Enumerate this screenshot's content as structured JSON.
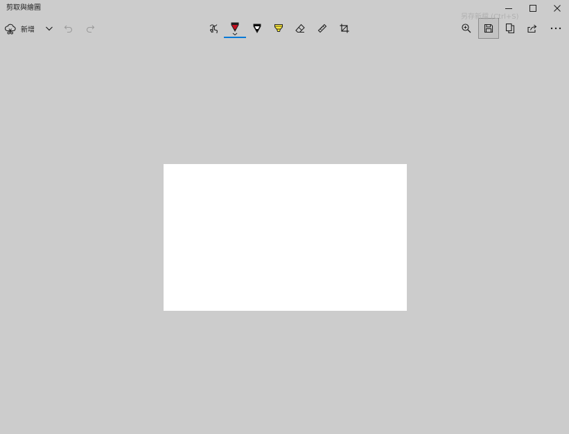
{
  "window": {
    "title": "剪取與繪圖"
  },
  "toolbar": {
    "new_label": "新增"
  },
  "tooltip": {
    "save_text": "另存新檔 (Ctrl+S)"
  },
  "colors": {
    "background": "#cccccc",
    "canvas": "#ffffff",
    "accent": "#0078d7",
    "ballpoint_pen": "#c50f1f",
    "pencil": "#000000",
    "highlighter": "#ffeb3b"
  },
  "icons": {
    "new_snip": "cloud-scissors-icon",
    "dropdown": "chevron-down-icon",
    "undo": "undo-icon",
    "redo": "redo-icon",
    "touch_writing": "touch-writing-icon",
    "ballpoint_pen": "ballpoint-pen-icon",
    "pencil": "pencil-icon",
    "highlighter": "highlighter-icon",
    "eraser": "eraser-icon",
    "ruler": "ruler-icon",
    "crop": "crop-icon",
    "zoom": "zoom-in-icon",
    "save": "save-icon",
    "copy": "copy-icon",
    "share": "share-icon",
    "more": "more-icon",
    "minimize": "minimize-icon",
    "maximize": "maximize-icon",
    "close": "close-icon"
  }
}
